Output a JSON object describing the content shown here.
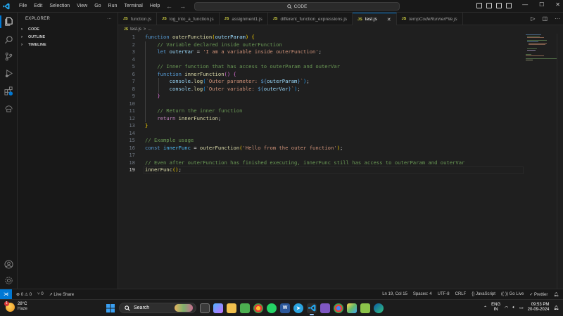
{
  "titlebar": {
    "menu": [
      "File",
      "Edit",
      "Selection",
      "View",
      "Go",
      "Run",
      "Terminal",
      "Help"
    ],
    "search": "CODE"
  },
  "sidebar": {
    "title": "EXPLORER",
    "more": "···",
    "sections": [
      "CODE",
      "OUTLINE",
      "TIMELINE"
    ]
  },
  "tabs": [
    {
      "label": "function.js",
      "active": false,
      "preview": false
    },
    {
      "label": "log_into_a_function.js",
      "active": false,
      "preview": false
    },
    {
      "label": "assignment1.js",
      "active": false,
      "preview": false
    },
    {
      "label": "different_function_expressions.js",
      "active": false,
      "preview": false
    },
    {
      "label": "test.js",
      "active": true,
      "preview": false
    },
    {
      "label": "tempCodeRunnerFile.js",
      "active": false,
      "preview": true
    }
  ],
  "tab_file_type": "JS",
  "breadcrumb": {
    "file": "test.js",
    "sep": ">",
    "rest": "..."
  },
  "editor": {
    "line_numbers": [
      "1",
      "2",
      "3",
      "4",
      "5",
      "6",
      "7",
      "8",
      "9",
      "10",
      "11",
      "12",
      "13",
      "14",
      "15",
      "16",
      "17",
      "18",
      "19"
    ],
    "current_line": "19"
  },
  "statusbar": {
    "problems": "⊗ 0 ⚠ 0",
    "ports": "⑂ 0",
    "live_share": "Live Share",
    "position": "Ln 19, Col 15",
    "spaces": "Spaces: 4",
    "encoding": "UTF-8",
    "eol": "CRLF",
    "language": "{} JavaScript",
    "go_live": "Go Live",
    "prettier": "✓ Prettier"
  },
  "taskbar": {
    "weather_temp": "28°C",
    "weather_desc": "Haze",
    "weather_badge": "1",
    "search": "Search",
    "lang_top": "ENG",
    "lang_bottom": "IN",
    "time": "09:53 PM",
    "date": "20-09-2024"
  },
  "colors": {
    "accent": "#0078d4",
    "keyword": "#569cd6",
    "function": "#dcdcaa",
    "variable": "#9cdcfe",
    "string": "#ce9178",
    "comment": "#6a9955"
  }
}
